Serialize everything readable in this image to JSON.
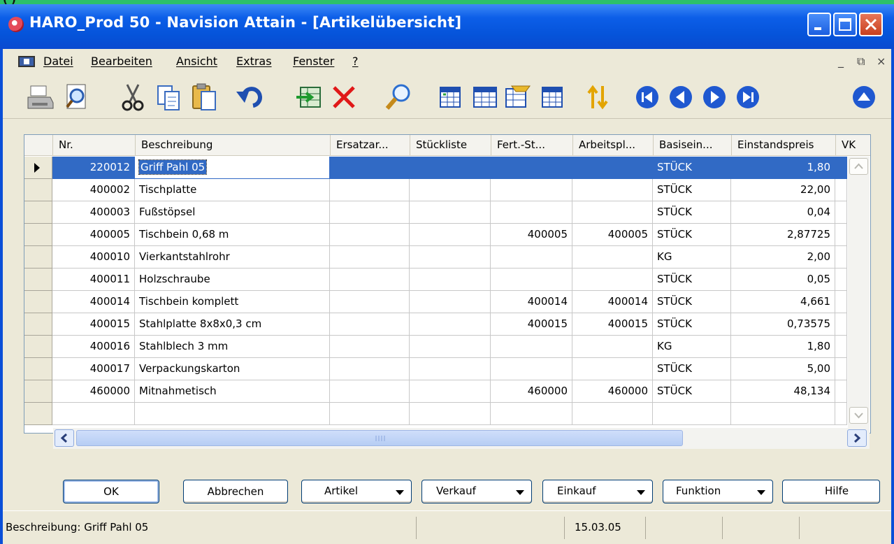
{
  "window": {
    "title": "HARO_Prod 50 - Navision Attain - [Artikelübersicht]",
    "behind_title_fragment": "(                              )"
  },
  "menu": {
    "items": [
      "Datei",
      "Bearbeiten",
      "Ansicht",
      "Extras",
      "Fenster",
      "?"
    ],
    "mdi_minimize": "_",
    "mdi_restore": "⧉",
    "mdi_close": "×"
  },
  "toolbar": {
    "icons": [
      "print-icon",
      "print-preview-icon",
      "cut-icon",
      "copy-icon",
      "paste-icon",
      "undo-icon",
      "insert-record-icon",
      "delete-icon",
      "find-icon",
      "filter-table-icon",
      "field-filter-icon",
      "flowfilter-icon",
      "show-all-icon",
      "sort-icon",
      "first-record-icon",
      "previous-record-icon",
      "next-record-icon",
      "last-record-icon",
      "up-icon"
    ]
  },
  "table": {
    "columns": [
      "Nr.",
      "Beschreibung",
      "Ersatzar...",
      "Stückliste",
      "Fert.-St...",
      "Arbeitspl...",
      "Basisein...",
      "Einstandspreis",
      "VK"
    ],
    "rows": [
      {
        "nr": "220012",
        "beschreibung": "Griff Pahl 05",
        "ersatz": "",
        "stueckliste": "",
        "fert": "",
        "arbeitsplan": "",
        "basiseinheit": "STÜCK",
        "einstandspreis": "1,80"
      },
      {
        "nr": "400002",
        "beschreibung": "Tischplatte",
        "ersatz": "",
        "stueckliste": "",
        "fert": "",
        "arbeitsplan": "",
        "basiseinheit": "STÜCK",
        "einstandspreis": "22,00"
      },
      {
        "nr": "400003",
        "beschreibung": "Fußstöpsel",
        "ersatz": "",
        "stueckliste": "",
        "fert": "",
        "arbeitsplan": "",
        "basiseinheit": "STÜCK",
        "einstandspreis": "0,04"
      },
      {
        "nr": "400005",
        "beschreibung": "Tischbein 0,68 m",
        "ersatz": "",
        "stueckliste": "",
        "fert": "400005",
        "arbeitsplan": "400005",
        "basiseinheit": "STÜCK",
        "einstandspreis": "2,87725"
      },
      {
        "nr": "400010",
        "beschreibung": "Vierkantstahlrohr",
        "ersatz": "",
        "stueckliste": "",
        "fert": "",
        "arbeitsplan": "",
        "basiseinheit": "KG",
        "einstandspreis": "2,00"
      },
      {
        "nr": "400011",
        "beschreibung": "Holzschraube",
        "ersatz": "",
        "stueckliste": "",
        "fert": "",
        "arbeitsplan": "",
        "basiseinheit": "STÜCK",
        "einstandspreis": "0,05"
      },
      {
        "nr": "400014",
        "beschreibung": "Tischbein komplett",
        "ersatz": "",
        "stueckliste": "",
        "fert": "400014",
        "arbeitsplan": "400014",
        "basiseinheit": "STÜCK",
        "einstandspreis": "4,661"
      },
      {
        "nr": "400015",
        "beschreibung": "Stahlplatte 8x8x0,3 cm",
        "ersatz": "",
        "stueckliste": "",
        "fert": "400015",
        "arbeitsplan": "400015",
        "basiseinheit": "STÜCK",
        "einstandspreis": "0,73575"
      },
      {
        "nr": "400016",
        "beschreibung": "Stahlblech 3 mm",
        "ersatz": "",
        "stueckliste": "",
        "fert": "",
        "arbeitsplan": "",
        "basiseinheit": "KG",
        "einstandspreis": "1,80"
      },
      {
        "nr": "400017",
        "beschreibung": "Verpackungskarton",
        "ersatz": "",
        "stueckliste": "",
        "fert": "",
        "arbeitsplan": "",
        "basiseinheit": "STÜCK",
        "einstandspreis": "5,00"
      },
      {
        "nr": "460000",
        "beschreibung": "Mitnahmetisch",
        "ersatz": "",
        "stueckliste": "",
        "fert": "460000",
        "arbeitsplan": "460000",
        "basiseinheit": "STÜCK",
        "einstandspreis": "48,134"
      },
      {
        "nr": "",
        "beschreibung": "",
        "ersatz": "",
        "stueckliste": "",
        "fert": "",
        "arbeitsplan": "",
        "basiseinheit": "",
        "einstandspreis": ""
      }
    ],
    "selected_row_index": 0
  },
  "buttons": {
    "ok": "OK",
    "abbrechen": "Abbrechen",
    "artikel": "Artikel",
    "verkauf": "Verkauf",
    "einkauf": "Einkauf",
    "funktion": "Funktion",
    "hilfe": "Hilfe"
  },
  "statusbar": {
    "description": "Beschreibung: Griff Pahl 05",
    "date": "15.03.05"
  },
  "colors": {
    "titlebar": "#0553d9",
    "selection": "#316ac5",
    "face": "#ece9d8"
  }
}
